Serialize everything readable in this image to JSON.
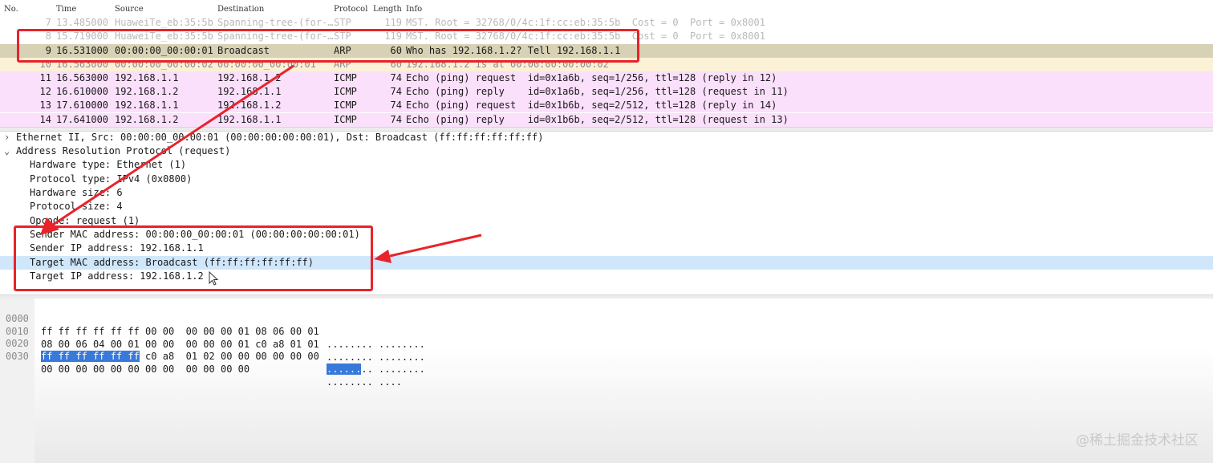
{
  "columns": {
    "no": "No.",
    "time": "Time",
    "source": "Source",
    "destination": "Destination",
    "protocol": "Protocol",
    "length": "Length",
    "info": "Info"
  },
  "packets": [
    {
      "no": "7",
      "time": "13.485000",
      "source": "HuaweiTe_eb:35:5b",
      "destination": "Spanning-tree-(for-…",
      "protocol": "STP",
      "length": "119",
      "info": "MST. Root = 32768/0/4c:1f:cc:eb:35:5b  Cost = 0  Port = 0x8001"
    },
    {
      "no": "8",
      "time": "15.719000",
      "source": "HuaweiTe_eb:35:5b",
      "destination": "Spanning-tree-(for-…",
      "protocol": "STP",
      "length": "119",
      "info": "MST. Root = 32768/0/4c:1f:cc:eb:35:5b  Cost = 0  Port = 0x8001"
    },
    {
      "no": "9",
      "time": "16.531000",
      "source": "00:00:00_00:00:01",
      "destination": "Broadcast",
      "protocol": "ARP",
      "length": "60",
      "info": "Who has 192.168.1.2? Tell 192.168.1.1"
    },
    {
      "no": "10",
      "time": "16.563000",
      "source": "00:00:00_00:00:02",
      "destination": "00:00:00_00:00:01",
      "protocol": "ARP",
      "length": "60",
      "info": "192.168.1.2 is at 00:00:00:00:00:02"
    },
    {
      "no": "11",
      "time": "16.563000",
      "source": "192.168.1.1",
      "destination": "192.168.1.2",
      "protocol": "ICMP",
      "length": "74",
      "info": "Echo (ping) request  id=0x1a6b, seq=1/256, ttl=128 (reply in 12)"
    },
    {
      "no": "12",
      "time": "16.610000",
      "source": "192.168.1.2",
      "destination": "192.168.1.1",
      "protocol": "ICMP",
      "length": "74",
      "info": "Echo (ping) reply    id=0x1a6b, seq=1/256, ttl=128 (request in 11)"
    },
    {
      "no": "13",
      "time": "17.610000",
      "source": "192.168.1.1",
      "destination": "192.168.1.2",
      "protocol": "ICMP",
      "length": "74",
      "info": "Echo (ping) request  id=0x1b6b, seq=2/512, ttl=128 (reply in 14)"
    },
    {
      "no": "14",
      "time": "17.641000",
      "source": "192.168.1.2",
      "destination": "192.168.1.1",
      "protocol": "ICMP",
      "length": "74",
      "info": "Echo (ping) reply    id=0x1b6b, seq=2/512, ttl=128 (request in 13)"
    }
  ],
  "details": [
    {
      "text": "Ethernet II, Src: 00:00:00_00:00:01 (00:00:00:00:00:01), Dst: Broadcast (ff:ff:ff:ff:ff:ff)",
      "expander": "›"
    },
    {
      "text": "Address Resolution Protocol (request)",
      "expander": "⌄"
    },
    {
      "text": "Hardware type: Ethernet (1)"
    },
    {
      "text": "Protocol type: IPv4 (0x0800)"
    },
    {
      "text": "Hardware size: 6"
    },
    {
      "text": "Protocol size: 4"
    },
    {
      "text": "Opcode: request (1)"
    },
    {
      "text": "Sender MAC address: 00:00:00_00:00:01 (00:00:00:00:00:01)"
    },
    {
      "text": "Sender IP address: 192.168.1.1"
    },
    {
      "text": "Target MAC address: Broadcast (ff:ff:ff:ff:ff:ff)"
    },
    {
      "text": "Target IP address: 192.168.1.2"
    }
  ],
  "hex": [
    {
      "offset": "0000",
      "pre": "",
      "sel": "",
      "bytes": "ff ff ff ff ff ff 00 00  00 00 00 01 08 06 00 01",
      "asel": "",
      "ascii": "........ ........"
    },
    {
      "offset": "0010",
      "pre": "",
      "sel": "",
      "bytes": "08 00 06 04 00 01 00 00  00 00 00 01 c0 a8 01 01",
      "asel": "",
      "ascii": "........ ........"
    },
    {
      "offset": "0020",
      "pre": "",
      "sel": "ff ff ff ff ff ff",
      "bytes": " c0 a8  01 02 00 00 00 00 00 00",
      "asel": "......",
      "ascii": ".. ........"
    },
    {
      "offset": "0030",
      "pre": "",
      "sel": "",
      "bytes": "00 00 00 00 00 00 00 00  00 00 00 00",
      "asel": "",
      "ascii": "........ ...."
    }
  ],
  "watermark": "@稀土掘金技术社区",
  "colors": {
    "annotation_red": "#e8232a",
    "selected_row": "#d7d1b5",
    "arp_row": "#fbf1d6",
    "icmp_row": "#fbe0fb",
    "detail_highlight": "#cfe6fb",
    "hex_selection": "#3879d9"
  }
}
